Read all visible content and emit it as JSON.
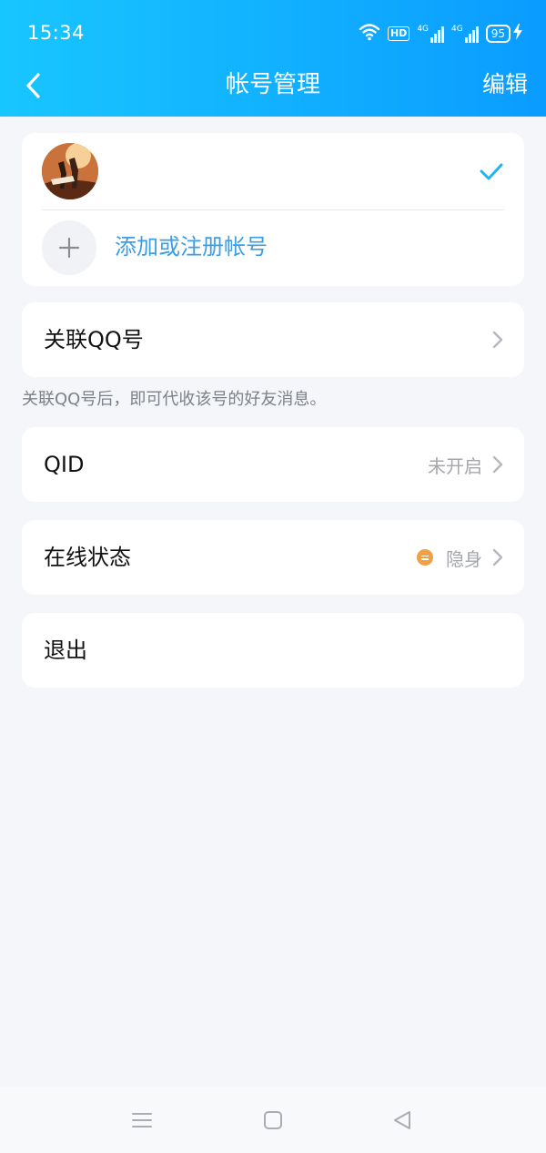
{
  "status_bar": {
    "time": "15:34",
    "hd": "HD",
    "network_1": "4G",
    "network_2": "4G",
    "battery": "95"
  },
  "nav": {
    "title": "帐号管理",
    "edit_label": "编辑"
  },
  "accounts": {
    "add_label": "添加或注册帐号"
  },
  "link_qq": {
    "label": "关联QQ号",
    "hint": "关联QQ号后，即可代收该号的好友消息。"
  },
  "qid": {
    "label": "QID",
    "value": "未开启"
  },
  "online_status": {
    "label": "在线状态",
    "value": "隐身"
  },
  "logout": {
    "label": "退出"
  },
  "colors": {
    "header_gradient_start": "#18c6ff",
    "header_gradient_end": "#0a9cff",
    "accent": "#3b9ee6",
    "check": "#1fb4f0",
    "status_dot": "#f2a046",
    "background": "#f5f6fa"
  },
  "icons": {
    "back": "chevron-left-icon",
    "check": "check-icon",
    "add": "plus-icon",
    "chevron": "chevron-right-icon",
    "status": "invisible-status-icon",
    "wifi": "wifi-icon",
    "battery": "battery-icon",
    "menu": "menu-icon",
    "home": "home-icon",
    "system_back": "back-triangle-icon"
  }
}
